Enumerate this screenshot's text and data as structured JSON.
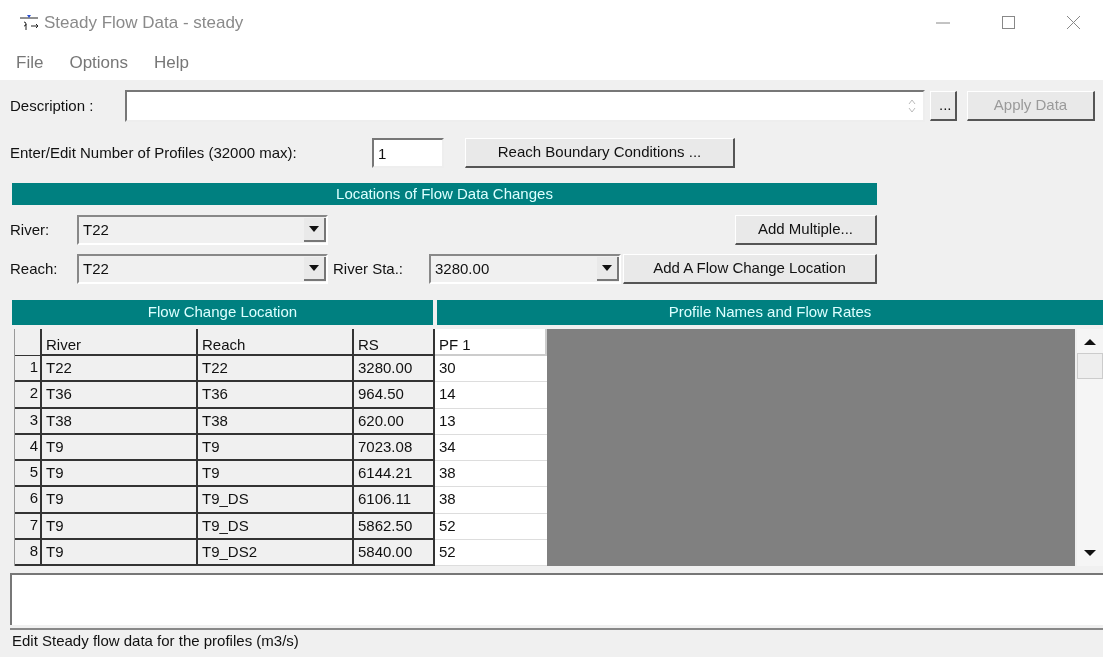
{
  "window": {
    "title": "Steady Flow Data - steady"
  },
  "menu": [
    "File",
    "Options",
    "Help"
  ],
  "description": {
    "label": "Description :",
    "ellipsis_button": "...",
    "apply_button": {
      "label": "Apply Data",
      "disabled": true
    }
  },
  "profiles": {
    "label": "Enter/Edit Number of Profiles (32000 max):",
    "value": "1",
    "button": "Reach Boundary Conditions ..."
  },
  "locations": {
    "header": "Locations of Flow Data Changes",
    "river": {
      "label": "River:",
      "value": "T22"
    },
    "reach": {
      "label": "Reach:",
      "value": "T22"
    },
    "river_sta": {
      "label": "River Sta.:",
      "value": "3280.00"
    },
    "add_multiple": "Add Multiple...",
    "add_location": "Add A Flow Change Location"
  },
  "table": {
    "left_header": "Flow Change Location",
    "right_header": "Profile Names and Flow Rates",
    "columns": [
      "River",
      "Reach",
      "RS",
      "PF 1"
    ],
    "rows": [
      {
        "number": "1",
        "river": "T22",
        "reach": "T22",
        "rs": "3280.00",
        "pf1": "30"
      },
      {
        "number": "2",
        "river": "T36",
        "reach": "T36",
        "rs": "964.50",
        "pf1": "14"
      },
      {
        "number": "3",
        "river": "T38",
        "reach": "T38",
        "rs": "620.00",
        "pf1": "13"
      },
      {
        "number": "4",
        "river": "T9",
        "reach": "T9",
        "rs": "7023.08",
        "pf1": "34"
      },
      {
        "number": "5",
        "river": "T9",
        "reach": "T9",
        "rs": "6144.21",
        "pf1": "38"
      },
      {
        "number": "6",
        "river": "T9",
        "reach": "T9_DS",
        "rs": "6106.11",
        "pf1": "38"
      },
      {
        "number": "7",
        "river": "T9",
        "reach": "T9_DS",
        "rs": "5862.50",
        "pf1": "52"
      },
      {
        "number": "8",
        "river": "T9",
        "reach": "T9_DS2",
        "rs": "5840.00",
        "pf1": "52"
      }
    ]
  },
  "status_bar": "Edit Steady flow data for the profiles (m3/s)"
}
